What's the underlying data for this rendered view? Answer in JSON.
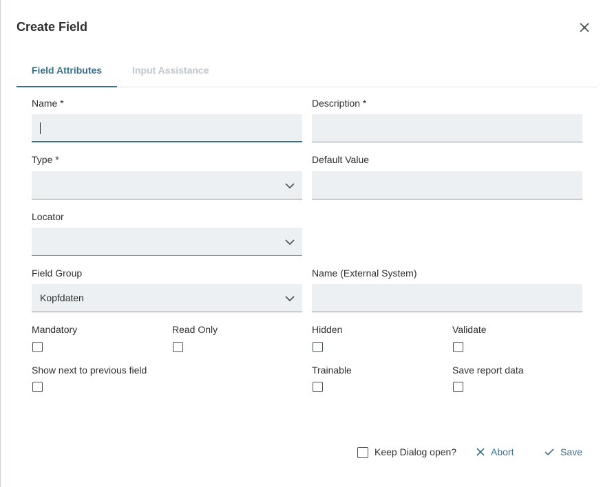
{
  "dialog": {
    "title": "Create Field",
    "close_icon": "close-icon"
  },
  "tabs": [
    {
      "label": "Field Attributes",
      "active": true
    },
    {
      "label": "Input Assistance",
      "active": false
    }
  ],
  "form": {
    "name": {
      "label": "Name *",
      "value": ""
    },
    "description": {
      "label": "Description *",
      "value": ""
    },
    "type": {
      "label": "Type *",
      "value": ""
    },
    "default_value": {
      "label": "Default Value",
      "value": ""
    },
    "locator": {
      "label": "Locator",
      "value": ""
    },
    "field_group": {
      "label": "Field Group",
      "value": "Kopfdaten"
    },
    "external_name": {
      "label": "Name (External System)",
      "value": ""
    },
    "checkboxes": [
      {
        "label": "Mandatory",
        "checked": false
      },
      {
        "label": "Read Only",
        "checked": false
      },
      {
        "label": "Hidden",
        "checked": false
      },
      {
        "label": "Validate",
        "checked": false
      },
      {
        "label": "Show next to previous field",
        "checked": false
      },
      {
        "label": "Trainable",
        "checked": false
      },
      {
        "label": "Save report data",
        "checked": false
      }
    ]
  },
  "footer": {
    "keep_open_label": "Keep Dialog open?",
    "keep_open_checked": false,
    "abort_label": "Abort",
    "save_label": "Save"
  },
  "colors": {
    "accent": "#3a6f8c",
    "field_bg": "#ecf0f3",
    "tab_inactive": "#bfc5ca"
  }
}
